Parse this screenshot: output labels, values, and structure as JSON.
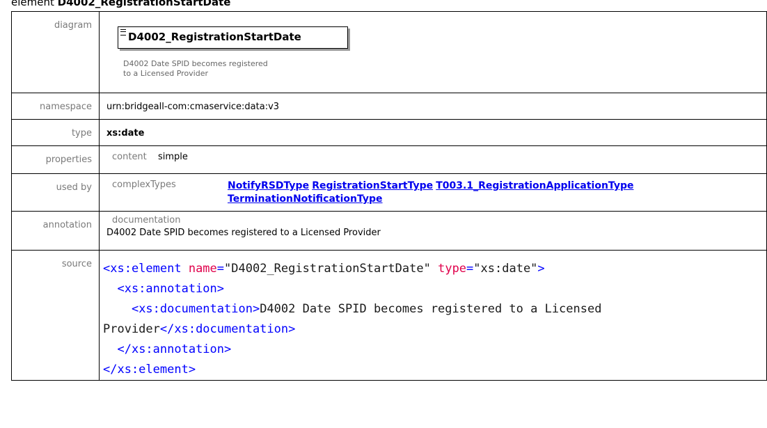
{
  "heading": {
    "prefix": "element",
    "name": "D4002_RegistrationStartDate"
  },
  "labels": {
    "diagram": "diagram",
    "namespace": "namespace",
    "type": "type",
    "properties": "properties",
    "used_by": "used by",
    "annotation": "annotation",
    "source": "source"
  },
  "diagram": {
    "element_name": "D4002_RegistrationStartDate",
    "doc_line1": "D4002 Date SPID becomes registered",
    "doc_line2": "to a Licensed Provider"
  },
  "namespace": "urn:bridgeall-com:cmaservice:data:v3",
  "type": "xs:date",
  "properties": {
    "label": "content",
    "value": "simple"
  },
  "used_by": {
    "label": "complexTypes",
    "links": [
      "NotifyRSDType",
      "RegistrationStartType",
      "T003.1_RegistrationApplicationType",
      "TerminationNotificationType"
    ]
  },
  "annotation": {
    "label": "documentation",
    "text": "D4002 Date SPID becomes registered to a Licensed Provider"
  },
  "source": {
    "el_open": "<xs:element ",
    "attr_name": "name",
    "name_val": "\"D4002_RegistrationStartDate\"",
    "attr_type": "type",
    "type_val": "\"xs:date\"",
    "gt": ">",
    "anno_open": "<xs:annotation>",
    "doc_open": "<xs:documentation>",
    "doc_text": "D4002 Date SPID becomes registered to a Licensed Provider",
    "doc_close": "</xs:documentation>",
    "anno_close": "</xs:annotation>",
    "el_close": "</xs:element>"
  },
  "colors": {
    "link": "#0000ee",
    "tag": "#a31515",
    "bracket": "#0000ff",
    "attr": "#e0004b"
  }
}
